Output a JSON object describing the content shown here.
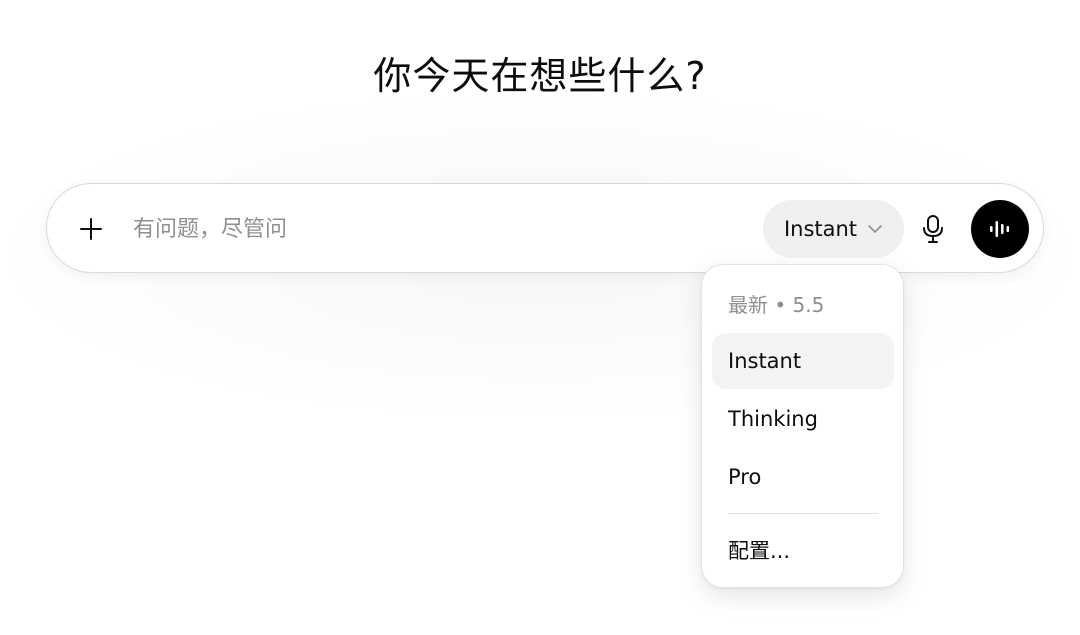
{
  "header": {
    "title": "你今天在想些什么?"
  },
  "composer": {
    "placeholder": "有问题，尽管问",
    "value": "",
    "plus_icon": "plus-icon",
    "model_selector": {
      "label": "Instant",
      "icon": "chevron-down-icon"
    },
    "mic_icon": "microphone-icon",
    "voice_icon": "voice-waveform-icon"
  },
  "model_menu": {
    "header": "最新 • 5.5",
    "items": [
      {
        "label": "Instant",
        "selected": true
      },
      {
        "label": "Thinking",
        "selected": false
      },
      {
        "label": "Pro",
        "selected": false
      }
    ],
    "configure_label": "配置..."
  },
  "colors": {
    "text": "#0d0d0d",
    "muted_text": "#8f8f8f",
    "pill_background": "#f0f0f0",
    "selected_item": "#f3f3f3",
    "voice_button": "#000000"
  }
}
